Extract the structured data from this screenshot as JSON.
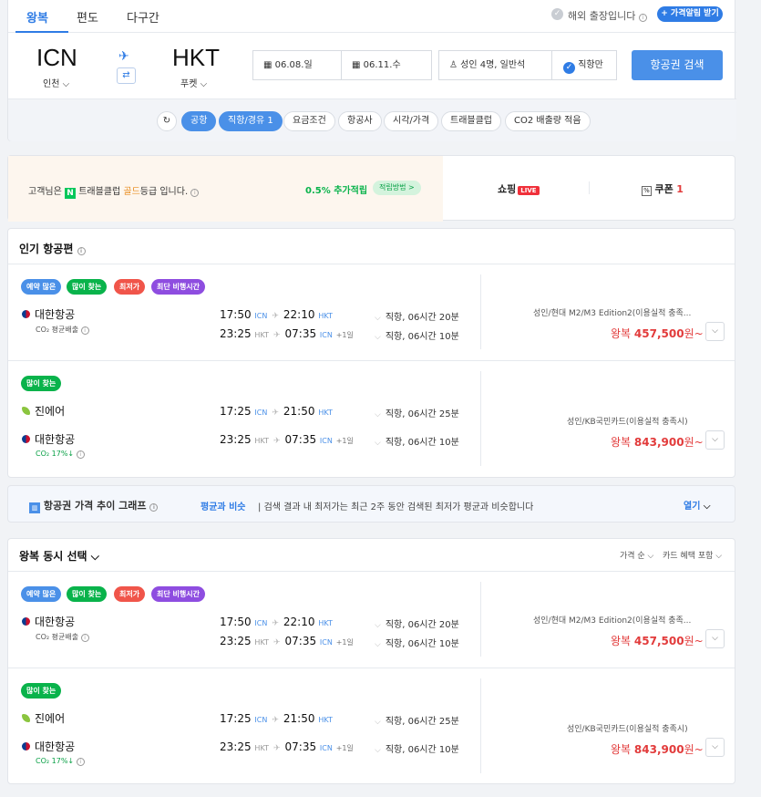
{
  "tabs": [
    "왕복",
    "편도",
    "다구간"
  ],
  "overseas_trip": "해외 출장입니다",
  "price_alert": "+ 가격알림 받기",
  "route": {
    "from_code": "ICN",
    "from_city": "인천 ⌵",
    "to_code": "HKT",
    "to_city": "푸켓 ⌵",
    "depart_date": "06.08.일",
    "return_date": "06.11.수",
    "passengers": "성인 4명, 일반석",
    "direct_only": "직항만",
    "search_button": "항공권 검색"
  },
  "filters": [
    "공항",
    "직항/경유 1",
    "요금조건",
    "항공사",
    "시각/가격",
    "트래블클럽",
    "CO2 배출량 적음"
  ],
  "benefit": {
    "grade_prefix": "고객님은",
    "grade_club": "트래블클럽",
    "grade_level": "골드",
    "grade_suffix": "등급 입니다.",
    "extra_points": "0.5% 추가적립",
    "points_method": "적립방법 >",
    "shopping": "쇼핑",
    "live": "LIVE",
    "coupon_label": "쿠폰",
    "coupon_count": "1"
  },
  "popular": {
    "title": "인기 항공편",
    "flights": [
      {
        "badges": [
          "예약 많은",
          "많이 찾는",
          "최저가",
          "최단 비행시간"
        ],
        "rows": [
          {
            "airline": "대한항공",
            "sub": "CO₂ 평균배출",
            "dep": "17:50",
            "dep_ap": "ICN",
            "arr": "22:10",
            "arr_ap": "HKT",
            "plus": "",
            "dur": "직항, 06시간 20분"
          },
          {
            "airline": "",
            "sub": "",
            "dep": "23:25",
            "dep_ap": "HKT",
            "arr": "07:35",
            "arr_ap": "ICN",
            "plus": "+1일",
            "dur": "직항, 06시간 10분"
          }
        ],
        "card": "성인/현대 M2/M3 Edition2(이용실적 충족...",
        "price_prefix": "왕복",
        "price": "457,500",
        "price_suffix": "원~"
      },
      {
        "badges": [
          "많이 찾는"
        ],
        "rows": [
          {
            "airline": "진에어",
            "sub": "",
            "dep": "17:25",
            "dep_ap": "ICN",
            "arr": "21:50",
            "arr_ap": "HKT",
            "plus": "",
            "dur": "직항, 06시간 25분"
          },
          {
            "airline": "대한항공",
            "sub": "CO₂ 17%↓",
            "dep": "23:25",
            "dep_ap": "HKT",
            "arr": "07:35",
            "arr_ap": "ICN",
            "plus": "+1일",
            "dur": "직항, 06시간 10분"
          }
        ],
        "card": "성인/KB국민카드(이용실적 충족시)",
        "price_prefix": "왕복",
        "price": "843,900",
        "price_suffix": "원~"
      }
    ]
  },
  "graph": {
    "title": "항공권 가격 추이 그래프",
    "status": "평균과 비슷",
    "desc": "검색 결과 내 최저가는 최근 2주 동안 검색된 최저가 평균과 비슷합니다",
    "open": "열기"
  },
  "roundtrip": {
    "title": "왕복 동시 선택",
    "sort": "가격 순 ⌵",
    "card_benefit": "카드 혜택 포함 ⌵",
    "flights": [
      {
        "badges": [
          "예약 많은",
          "많이 찾는",
          "최저가",
          "최단 비행시간"
        ],
        "rows": [
          {
            "airline": "대한항공",
            "sub": "CO₂ 평균배출",
            "dep": "17:50",
            "dep_ap": "ICN",
            "arr": "22:10",
            "arr_ap": "HKT",
            "plus": "",
            "dur": "직항, 06시간 20분"
          },
          {
            "airline": "",
            "sub": "",
            "dep": "23:25",
            "dep_ap": "HKT",
            "arr": "07:35",
            "arr_ap": "ICN",
            "plus": "+1일",
            "dur": "직항, 06시간 10분"
          }
        ],
        "card": "성인/현대 M2/M3 Edition2(이용실적 충족...",
        "price_prefix": "왕복",
        "price": "457,500",
        "price_suffix": "원~"
      },
      {
        "badges": [
          "많이 찾는"
        ],
        "rows": [
          {
            "airline": "진에어",
            "sub": "",
            "dep": "17:25",
            "dep_ap": "ICN",
            "arr": "21:50",
            "arr_ap": "HKT",
            "plus": "",
            "dur": "직항, 06시간 25분"
          },
          {
            "airline": "대한항공",
            "sub": "CO₂ 17%↓",
            "dep": "23:25",
            "dep_ap": "HKT",
            "arr": "07:35",
            "arr_ap": "ICN",
            "plus": "+1일",
            "dur": "직항, 06시간 10분"
          }
        ],
        "card": "성인/KB국민카드(이용실적 충족시)",
        "price_prefix": "왕복",
        "price": "843,900",
        "price_suffix": "원~"
      }
    ]
  }
}
